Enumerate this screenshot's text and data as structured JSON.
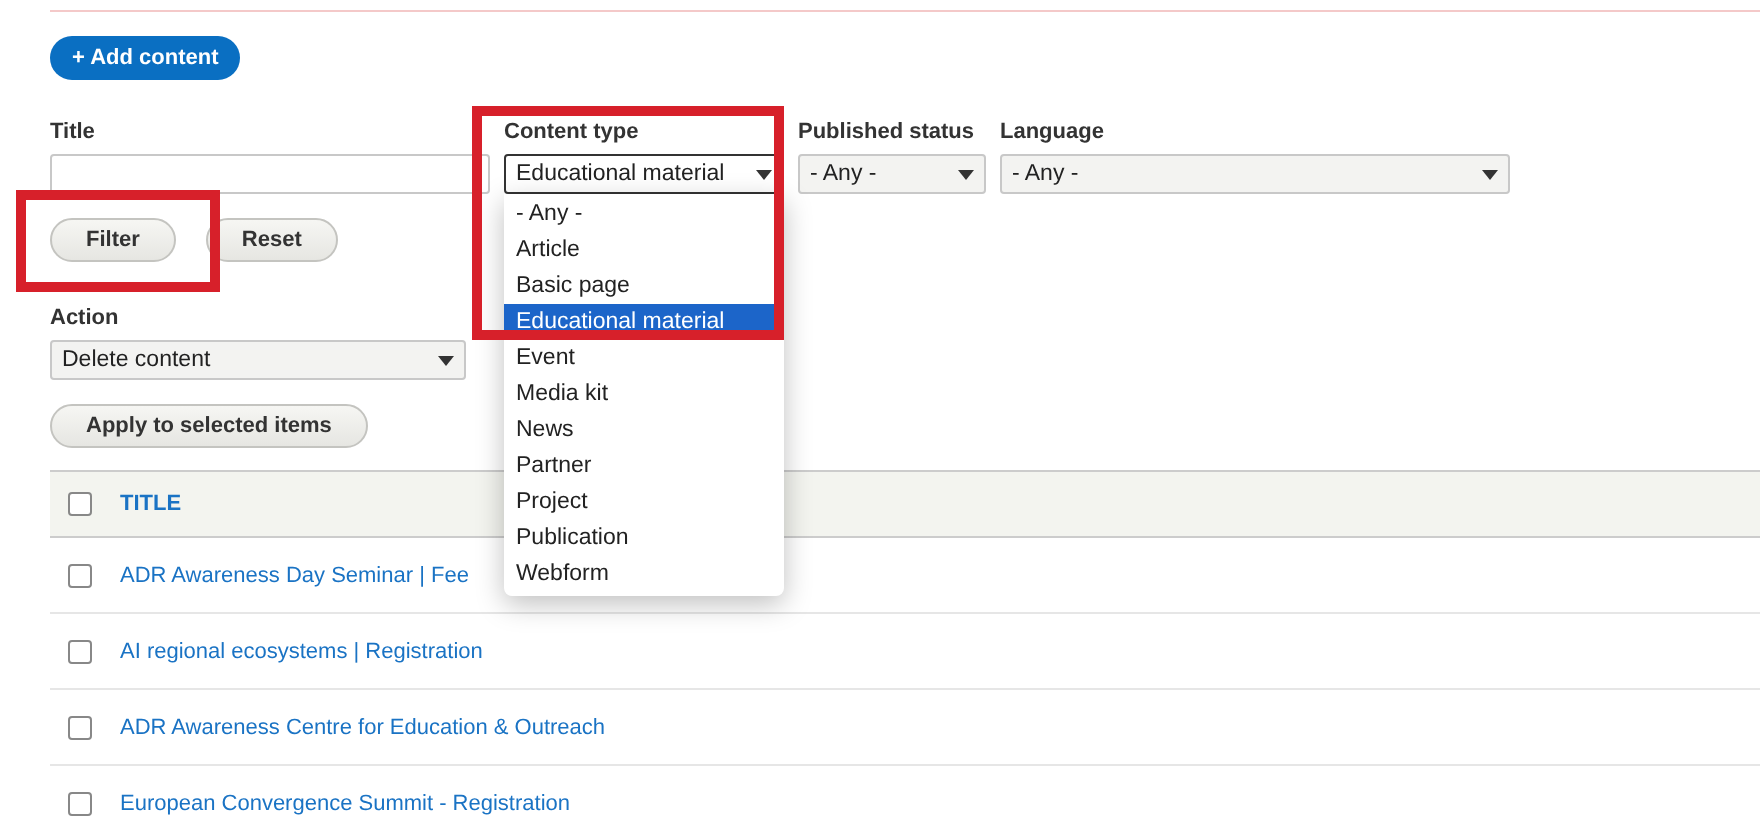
{
  "add_button": "+ Add content",
  "filters": [
    {
      "kind": "text",
      "label": "Title"
    },
    {
      "kind": "select",
      "label": "Content type",
      "value": "Educational material",
      "open": true,
      "options": [
        {
          "label": "- Any -",
          "selected": false
        },
        {
          "label": "Article",
          "selected": false
        },
        {
          "label": "Basic page",
          "selected": false
        },
        {
          "label": "Educational material",
          "selected": true
        },
        {
          "label": "Event",
          "selected": false
        },
        {
          "label": "Media kit",
          "selected": false
        },
        {
          "label": "News",
          "selected": false
        },
        {
          "label": "Partner",
          "selected": false
        },
        {
          "label": "Project",
          "selected": false
        },
        {
          "label": "Publication",
          "selected": false
        },
        {
          "label": "Webform",
          "selected": false
        }
      ]
    },
    {
      "kind": "select",
      "label": "Published status",
      "value": "- Any -",
      "open": false
    },
    {
      "kind": "select",
      "label": "Language",
      "value": "- Any -",
      "open": false
    }
  ],
  "filter_buttons": [
    "Filter",
    "Reset"
  ],
  "action": {
    "label": "Action",
    "value": "Delete content"
  },
  "apply_button": "Apply to selected items",
  "table": {
    "columns": [
      "TITLE"
    ],
    "header_checked": false,
    "rows": [
      {
        "title": "ADR Awareness Day Seminar | Fee",
        "checked": false
      },
      {
        "title": "AI regional ecosystems | Registration",
        "checked": false
      },
      {
        "title": "ADR Awareness Centre for Education & Outreach",
        "checked": false
      },
      {
        "title": "European Convergence Summit - Registration",
        "checked": false
      }
    ]
  }
}
